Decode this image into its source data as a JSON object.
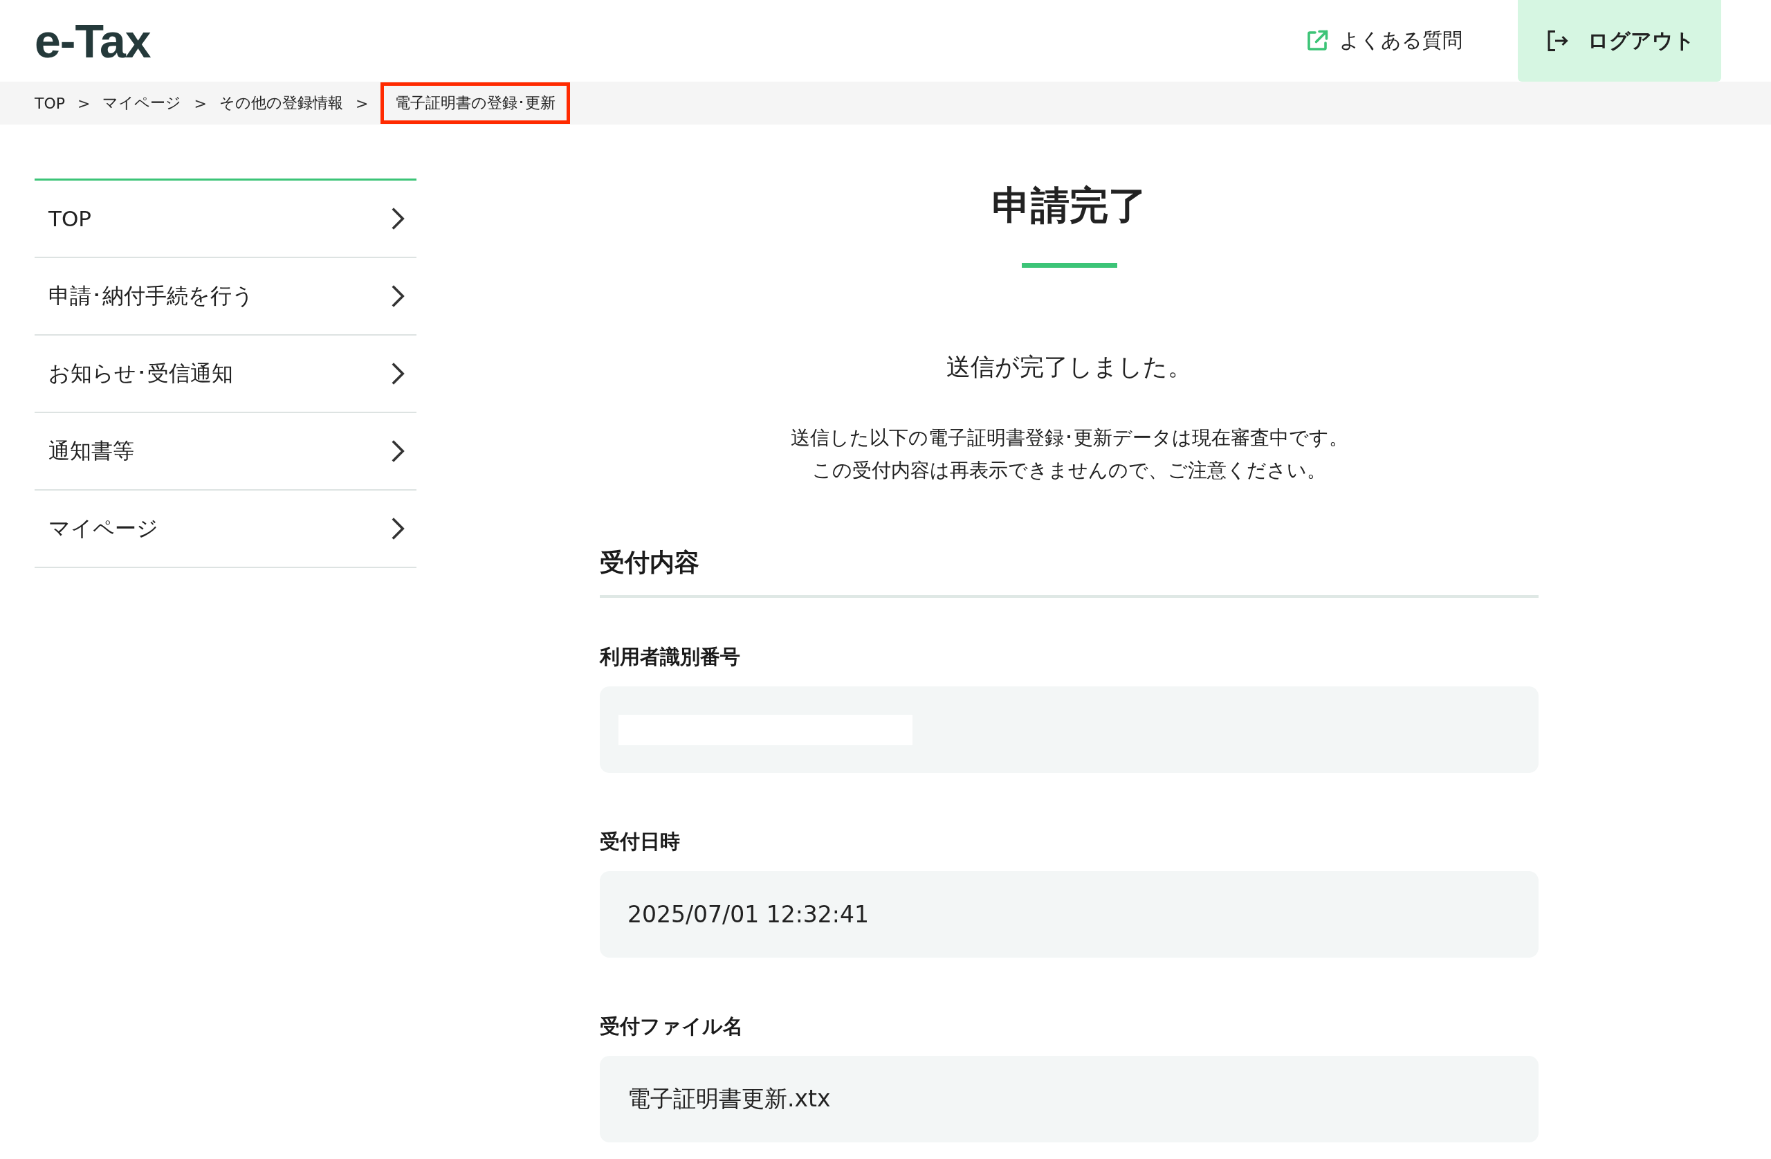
{
  "header": {
    "logo": "e-Tax",
    "faq_link": "よくある質問",
    "logout_button": "ログアウト"
  },
  "breadcrumb": [
    {
      "label": "TOP",
      "current": false,
      "highlighted": false
    },
    {
      "label": "マイページ",
      "current": false,
      "highlighted": false
    },
    {
      "label": "その他の登録情報",
      "current": false,
      "highlighted": false
    },
    {
      "label": "電子証明書の登録･更新",
      "current": true,
      "highlighted": true
    }
  ],
  "breadcrumb_separator": ">",
  "sidebar": {
    "items": [
      {
        "label": "TOP"
      },
      {
        "label": "申請･納付手続を行う"
      },
      {
        "label": "お知らせ･受信通知"
      },
      {
        "label": "通知書等"
      },
      {
        "label": "マイページ"
      }
    ]
  },
  "main": {
    "title": "申請完了",
    "message": "送信が完了しました。",
    "description": [
      "送信した以下の電子証明書登録･更新データは現在審査中です。",
      "この受付内容は再表示できませんので、ご注意ください。"
    ],
    "section_title": "受付内容",
    "fields": [
      {
        "label": "利用者識別番号",
        "redacted": true
      },
      {
        "label": "受付日時",
        "value": "2025/07/01 12:32:41",
        "redacted": false
      },
      {
        "label": "受付ファイル名",
        "value": "電子証明書更新.xtx",
        "redacted": false
      }
    ]
  }
}
